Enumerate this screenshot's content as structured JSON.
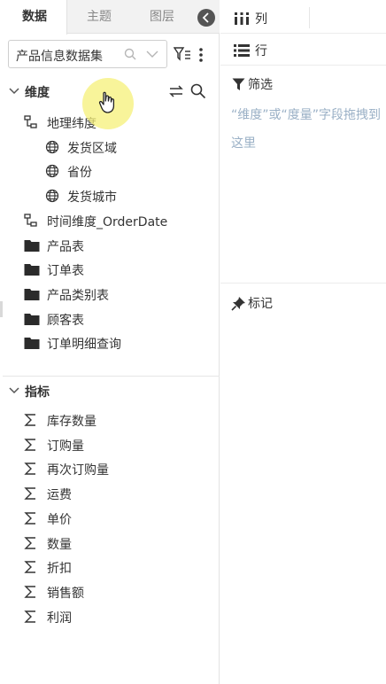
{
  "tabs": [
    {
      "label": "数据",
      "active": true
    },
    {
      "label": "主题",
      "active": false
    },
    {
      "label": "图层",
      "active": false
    }
  ],
  "dataset": {
    "value": "产品信息数据集"
  },
  "dimensions": {
    "title": "维度",
    "items": [
      {
        "label": "地理纬度",
        "icon": "hierarchy-icon",
        "level": 0
      },
      {
        "label": "发货区域",
        "icon": "globe-icon",
        "level": 1
      },
      {
        "label": "省份",
        "icon": "globe-icon",
        "level": 1
      },
      {
        "label": "发货城市",
        "icon": "globe-icon",
        "level": 1
      },
      {
        "label": "时间维度_OrderDate",
        "icon": "hierarchy-icon",
        "level": 0
      },
      {
        "label": "产品表",
        "icon": "folder-icon",
        "level": 0
      },
      {
        "label": "订单表",
        "icon": "folder-icon",
        "level": 0
      },
      {
        "label": "产品类别表",
        "icon": "folder-icon",
        "level": 0
      },
      {
        "label": "顾客表",
        "icon": "folder-icon",
        "level": 0
      },
      {
        "label": "订单明细查询",
        "icon": "folder-icon",
        "level": 0
      }
    ]
  },
  "measures": {
    "title": "指标",
    "items": [
      {
        "label": "库存数量",
        "icon": "sigma-icon"
      },
      {
        "label": "订购量",
        "icon": "sigma-icon"
      },
      {
        "label": "再次订购量",
        "icon": "sigma-icon"
      },
      {
        "label": "运费",
        "icon": "sigma-icon"
      },
      {
        "label": "单价",
        "icon": "sigma-icon"
      },
      {
        "label": "数量",
        "icon": "sigma-icon"
      },
      {
        "label": "折扣",
        "icon": "sigma-icon"
      },
      {
        "label": "销售额",
        "icon": "sigma-icon"
      },
      {
        "label": "利润",
        "icon": "sigma-icon"
      }
    ]
  },
  "shelves": {
    "columns": "列",
    "rows": "行",
    "filter": "筛选",
    "filter_hint": "“维度”或“度量”字段拖拽到这里",
    "marks": "标记"
  },
  "colors": {
    "hint_text": "#9ab0c6",
    "hover_highlight": "#f6f078",
    "dark_icon": "#333333"
  }
}
